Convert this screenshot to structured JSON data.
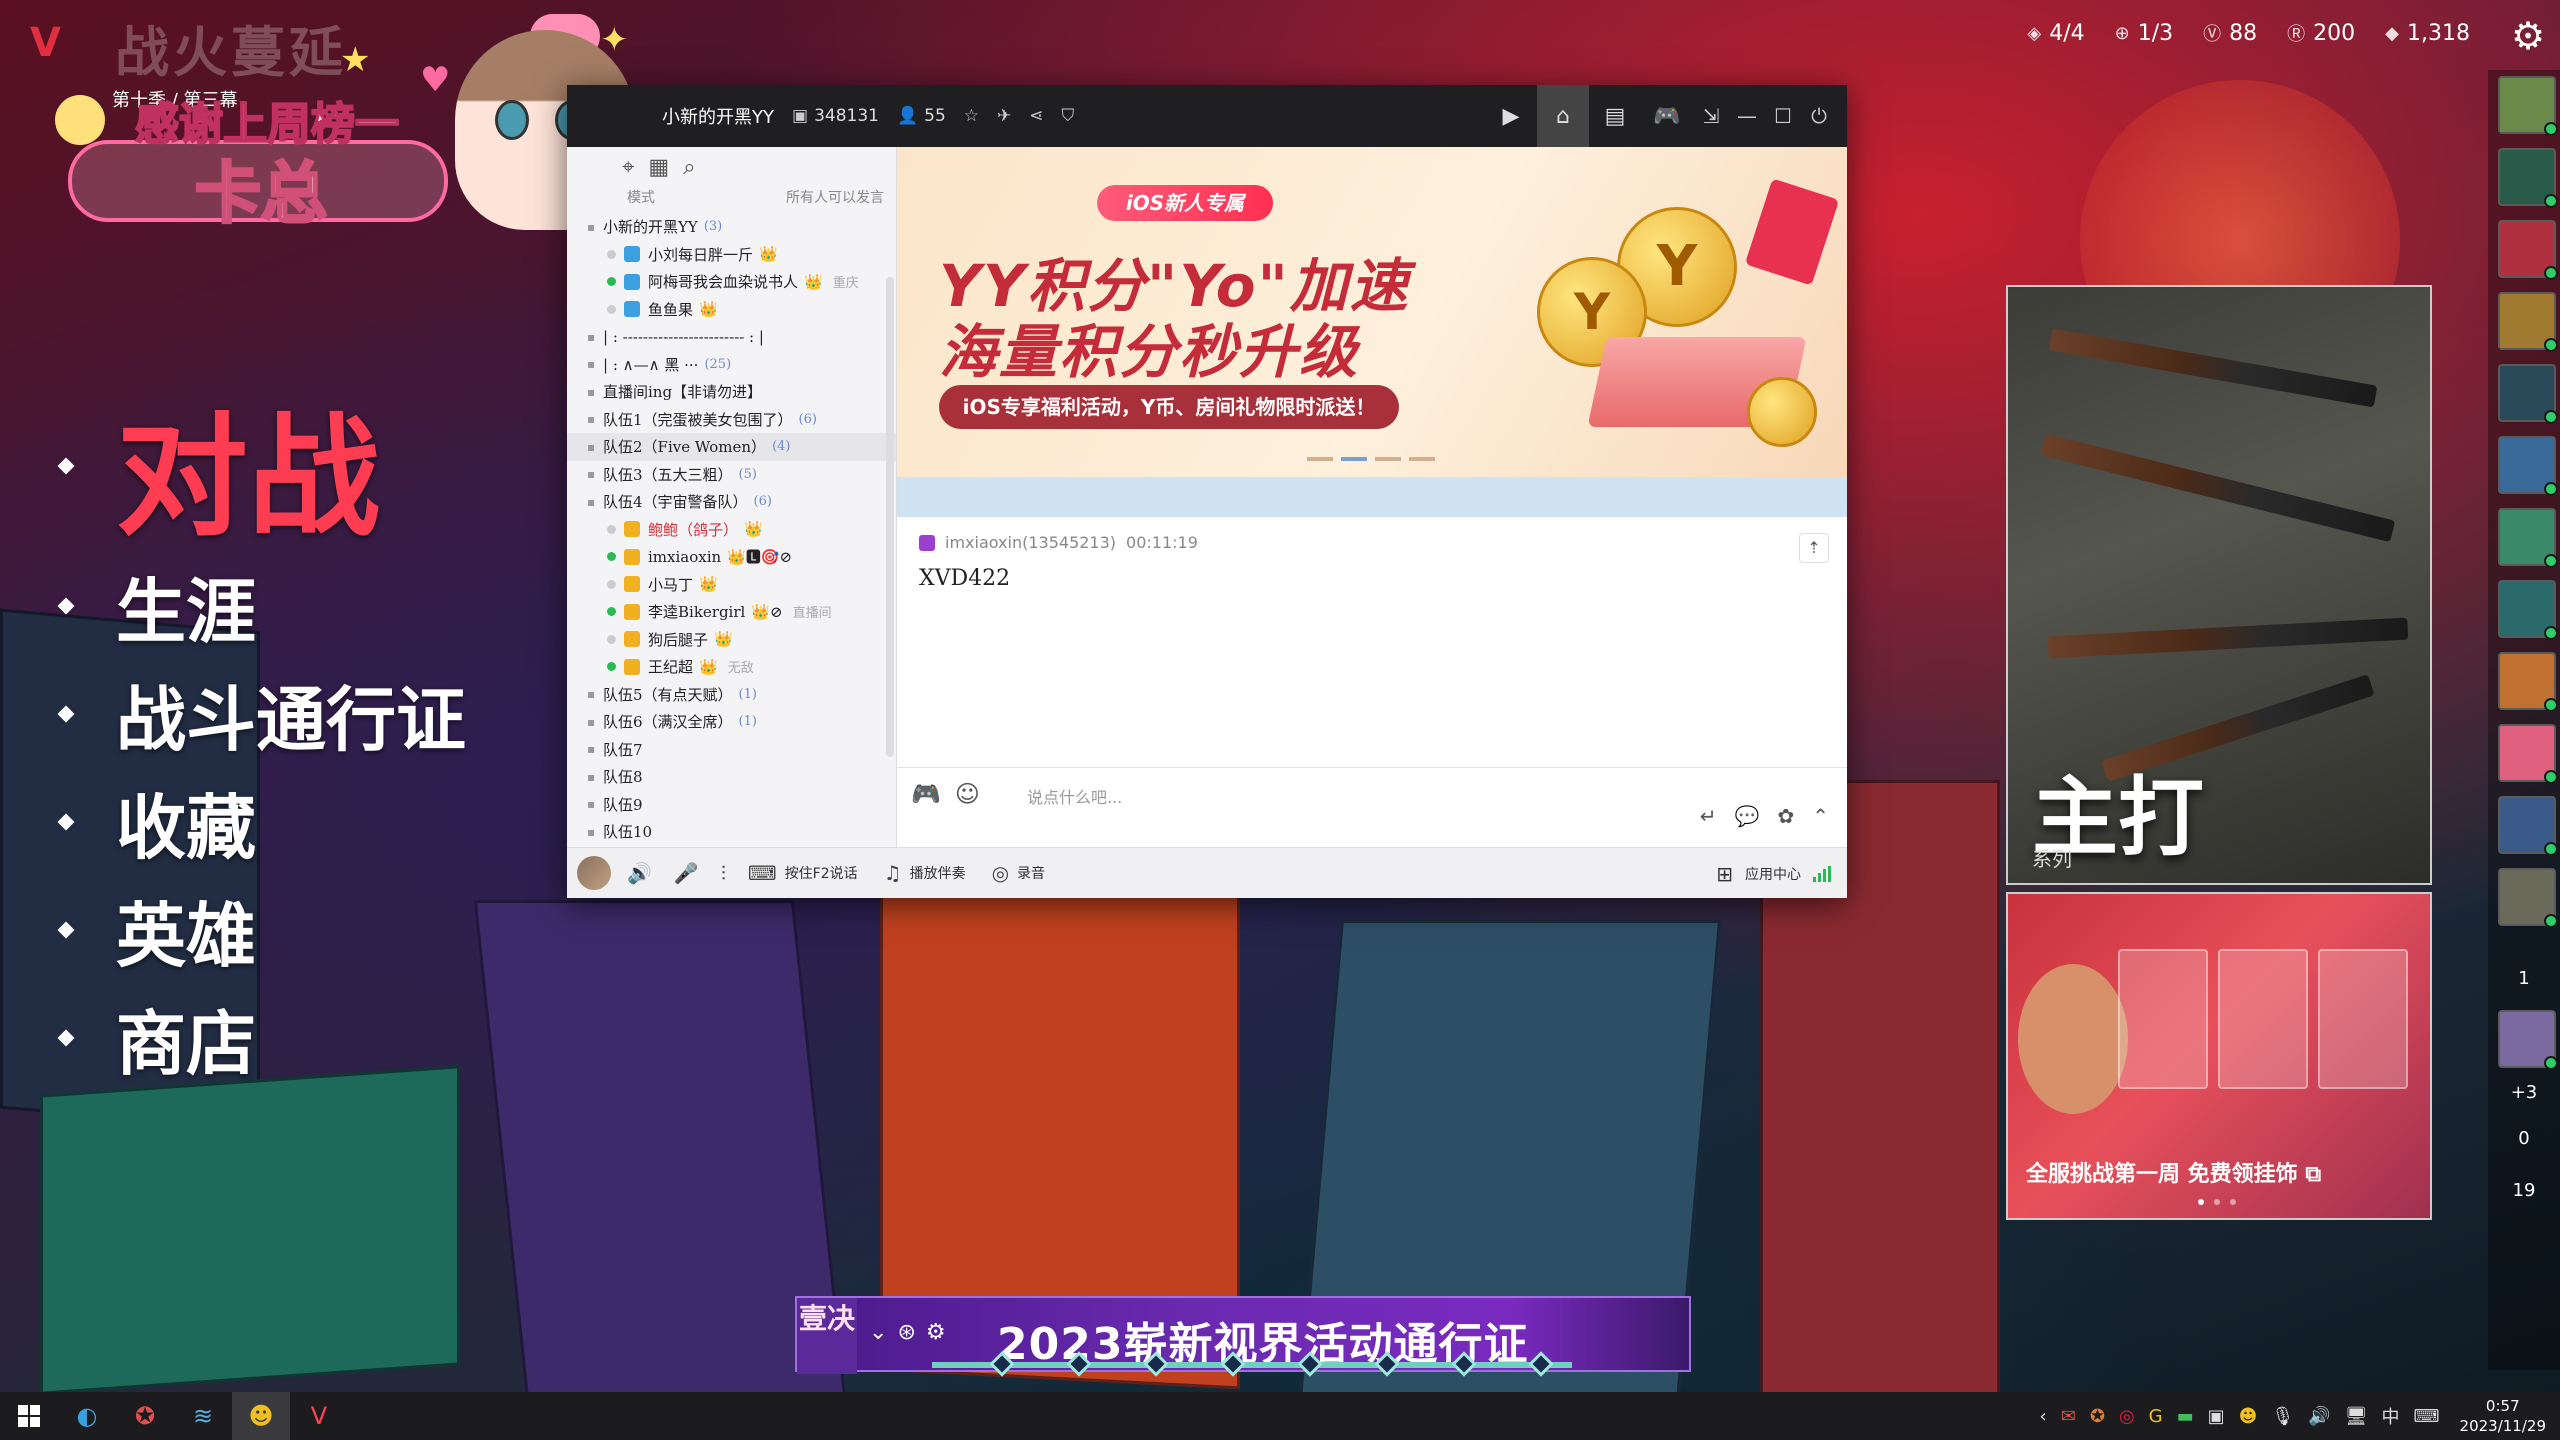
{
  "top_stats": [
    {
      "icon": "diamond-icon",
      "value": "4/4"
    },
    {
      "icon": "plus-circle-icon",
      "value": "1/3"
    },
    {
      "icon": "valorant-points-icon",
      "value": "88"
    },
    {
      "icon": "radianite-icon",
      "value": "200"
    },
    {
      "icon": "kingdom-credits-icon",
      "value": "1,318"
    }
  ],
  "overlay": {
    "title": "战火蔓延",
    "subtitle": "第十季 / 第三幕",
    "thanks": "感谢上周榜一",
    "name": "卡总"
  },
  "game_menu": [
    {
      "label": "对战",
      "active": true
    },
    {
      "label": "生涯",
      "active": false
    },
    {
      "label": "战斗通行证",
      "active": false
    },
    {
      "label": "收藏",
      "active": false
    },
    {
      "label": "英雄",
      "active": false
    },
    {
      "label": "商店",
      "active": false
    }
  ],
  "yy": {
    "channel_name": "小新的开黑YY",
    "channel_id": "348131",
    "online_count": "55",
    "left_header": {
      "mode": "模式",
      "permission": "所有人可以发言"
    },
    "tree": [
      {
        "type": "channel",
        "label": "小新的开黑YY",
        "count": "(3)"
      },
      {
        "type": "user",
        "label": "小刘每日胖一斤",
        "badge": "👑"
      },
      {
        "type": "user",
        "label": "阿梅哥我会血染说书人",
        "badge": "👑",
        "note": "重庆"
      },
      {
        "type": "user",
        "label": "鱼鱼果",
        "badge": "👑"
      },
      {
        "type": "channel",
        "label": "| :  ------------------------  : |",
        "count": ""
      },
      {
        "type": "channel",
        "label": "| :        ∧—∧      黑        ···",
        "count": "(25)"
      },
      {
        "type": "sub",
        "label": "直播间ing【非请勿进】",
        "count": ""
      },
      {
        "type": "sub",
        "label": "队伍1（完蛋被美女包围了）",
        "count": "(6)"
      },
      {
        "type": "sub",
        "label": "队伍2（Five Women）",
        "count": "(4)",
        "selected": true
      },
      {
        "type": "sub",
        "label": "队伍3（五大三粗）",
        "count": "(5)"
      },
      {
        "type": "sub",
        "label": "队伍4（宇宙警备队）",
        "count": "(6)"
      },
      {
        "type": "member",
        "label": "鲍鲍（鸽子）",
        "badge": "👑",
        "red": true
      },
      {
        "type": "member",
        "label": "imxiaoxin",
        "badge": "👑🅻🎯⊘"
      },
      {
        "type": "member",
        "label": "小马丁",
        "badge": "👑"
      },
      {
        "type": "member",
        "label": "李逵Bikergirl",
        "badge": "👑⊘",
        "note": "直播间"
      },
      {
        "type": "member",
        "label": "狗后腿子",
        "badge": "👑"
      },
      {
        "type": "member",
        "label": "王纪超",
        "badge": "👑",
        "note": "无敌"
      },
      {
        "type": "sub",
        "label": "队伍5（有点天赋）",
        "count": "(1)"
      },
      {
        "type": "sub",
        "label": "队伍6（满汉全席）",
        "count": "(1)"
      },
      {
        "type": "sub",
        "label": "队伍7",
        "count": ""
      },
      {
        "type": "sub",
        "label": "队伍8",
        "count": ""
      },
      {
        "type": "sub",
        "label": "队伍9",
        "count": ""
      },
      {
        "type": "sub",
        "label": "队伍10",
        "count": ""
      }
    ],
    "banner": {
      "tag": "iOS新人专属",
      "headline1": "YY积分\"Yo\"加速",
      "headline2": "海量积分秒升级",
      "pill": "iOS专享福利活动，Y币、房间礼物限时派送！"
    },
    "message": {
      "sender": "imxiaoxin(13545213)",
      "time": "00:11:19",
      "text": "XVD422"
    },
    "input_placeholder": "说点什么吧...",
    "bottom": {
      "ptt": "按住F2说话",
      "music": "播放伴奏",
      "record": "录音",
      "app_center": "应用中心"
    }
  },
  "right_panels": {
    "weapons_title": "主打",
    "weapons_sub": "系列",
    "event_text": "全服挑战第一周 免费领挂饰"
  },
  "friends_counts": [
    "1",
    "+3",
    "0",
    "19"
  ],
  "battlepass": {
    "left": "壹决",
    "title": "2023崭新视界活动通行证"
  },
  "taskbar": {
    "time": "0:57",
    "date": "2023/11/29",
    "ime": "中"
  }
}
